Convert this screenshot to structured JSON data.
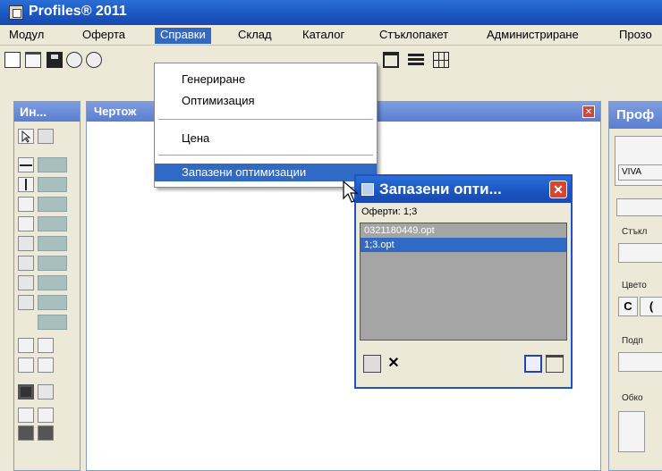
{
  "window": {
    "title": "Profiles® 2011"
  },
  "menubar": {
    "items": [
      "Модул",
      "Оферта",
      "Справки",
      "Склад",
      "Каталог",
      "Стъклопакет",
      "Администриране",
      "Прозо"
    ]
  },
  "palette": {
    "title": "Ин..."
  },
  "drawing": {
    "title": "Чертож"
  },
  "right_panel": {
    "title": "Проф",
    "field1": "VIVA",
    "labels": [
      "Стъкл",
      "Цвето",
      "Подп",
      "Обко"
    ],
    "color_buttons": [
      "C",
      "("
    ]
  },
  "dropdown": {
    "items": [
      "Генериране",
      "Оптимизация",
      "Цена",
      "Запазени оптимизации"
    ],
    "selected_index": 3
  },
  "saved_window": {
    "title": "Запазени опти...",
    "close_glyph": "✕",
    "label": "Оферти: 1;3",
    "files": [
      "0321180449.opt",
      "1;3.opt"
    ],
    "selected_file_index": 1,
    "delete_glyph": "✕"
  },
  "colors": {
    "accent": "#316ac5",
    "titlebar": "#1a55c0",
    "list_bg": "#a5a5a5"
  }
}
